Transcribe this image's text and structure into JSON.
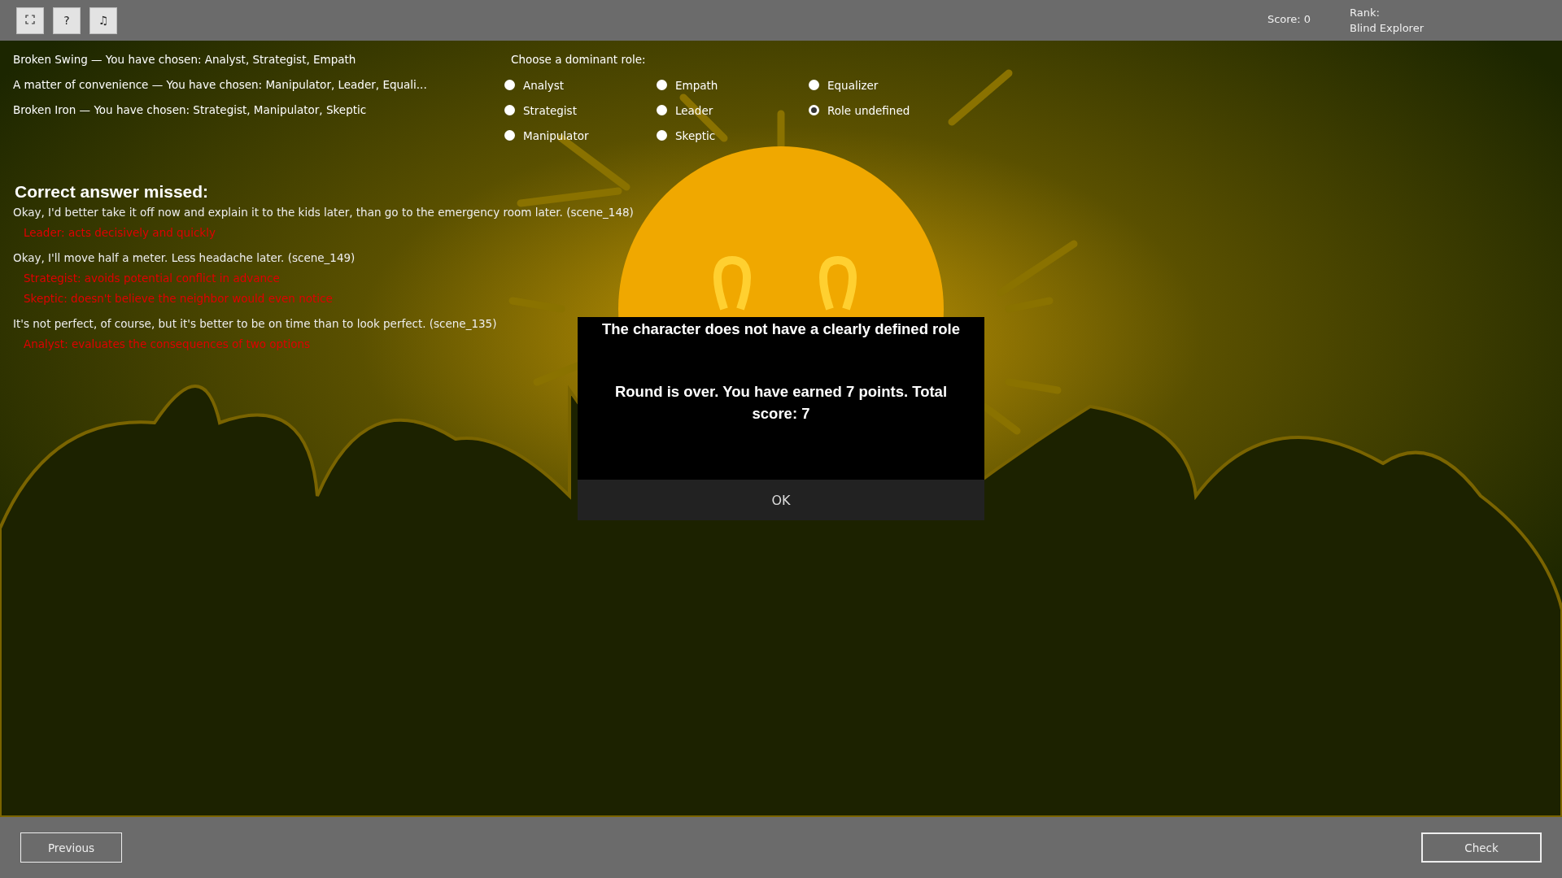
{
  "toolbar": {
    "buttons": [
      {
        "kind": "fullscreen"
      },
      {
        "kind": "help",
        "label": "?"
      },
      {
        "kind": "music",
        "label": "♫"
      }
    ],
    "score": "Score: 0",
    "rank_label": "Rank:",
    "rank": "Blind Explorer"
  },
  "history": [
    {
      "text": "Broken Swing — You have chosen: Analyst, Strategist, Empath"
    },
    {
      "text": "A matter of convenience — You have chosen: Manipulator, Leader, Equali..."
    },
    {
      "text": "Broken Iron — You have chosen: Strategist, Manipulator, Skeptic"
    }
  ],
  "role_choice": {
    "prompt": "Choose a dominant role:",
    "options": [
      {
        "label": "Analyst",
        "selected": false
      },
      {
        "label": "Strategist",
        "selected": false
      },
      {
        "label": "Manipulator",
        "selected": false
      },
      {
        "label": "Empath",
        "selected": false
      },
      {
        "label": "Leader",
        "selected": false
      },
      {
        "label": "Skeptic",
        "selected": false
      },
      {
        "label": "Equalizer",
        "selected": false
      },
      {
        "label": "Role undefined",
        "selected": true
      }
    ]
  },
  "missed": {
    "title": "Correct answer missed:",
    "items": [
      {
        "quote": "Okay, I'd better take it off now and explain it to the kids later, than go to the emergency room later. (scene_148)",
        "reasons": [
          "Leader: acts decisively and quickly"
        ]
      },
      {
        "quote": "Okay, I'll move half a meter. Less headache later. (scene_149)",
        "reasons": [
          "Strategist: avoids potential conflict in advance",
          "Skeptic: doesn't believe the neighbor would even notice"
        ]
      },
      {
        "quote": "It's not perfect, of course, but it's better to be on time than to look perfect. (scene_135)",
        "reasons": [
          "Analyst: evaluates the consequences of two options"
        ]
      }
    ]
  },
  "dialog": {
    "title": "The character does not have a clearly defined role",
    "message": "Round is over. You have earned 7 points. Total score: 7",
    "button": "OK"
  },
  "footer": {
    "previous": "Previous",
    "check": "Check"
  }
}
